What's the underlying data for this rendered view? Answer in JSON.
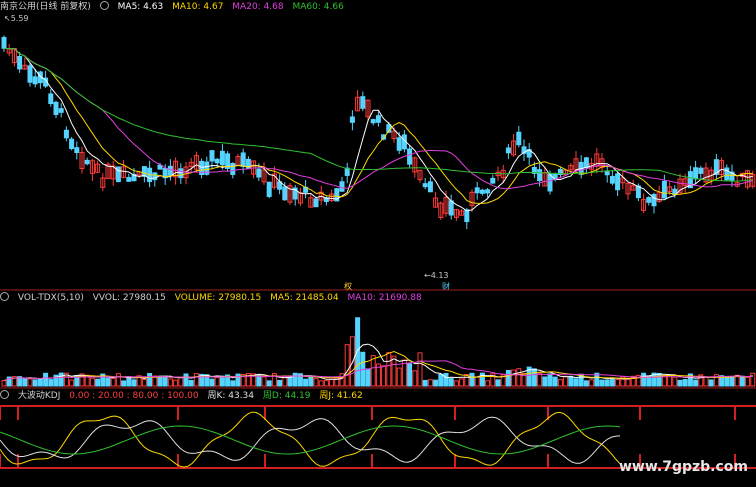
{
  "price_panel": {
    "title": "南京公用(日线 前复权)",
    "ma5": "MA5: 4.63",
    "ma10": "MA10: 4.67",
    "ma20": "MA20: 4.68",
    "ma60": "MA60: 4.66",
    "high_marker": "5.59",
    "low_marker": "4.13",
    "event_markers": [
      "权",
      "财"
    ]
  },
  "volume_panel": {
    "title": "VOL-TDX(5,10)",
    "vvol": "VVOL: 27980.15",
    "volume": "VOLUME: 27980.15",
    "ma5": "MA5: 21485.04",
    "ma10": "MA10: 21690.88"
  },
  "kdj_panel": {
    "title": "大波动KDJ",
    "levels": "0.00 : 20.00 : 80.00 : 100.00",
    "k": "周K: 43.34",
    "d": "周D: 44.19",
    "j": "周J: 41.62"
  },
  "watermark": "www.7gpzb.com",
  "colors": {
    "up": "#ff3b3b",
    "down": "#54d4ff",
    "ma5": "#ffffff",
    "ma10": "#ffd700",
    "ma20": "#e040e0",
    "ma60": "#30c030"
  }
}
